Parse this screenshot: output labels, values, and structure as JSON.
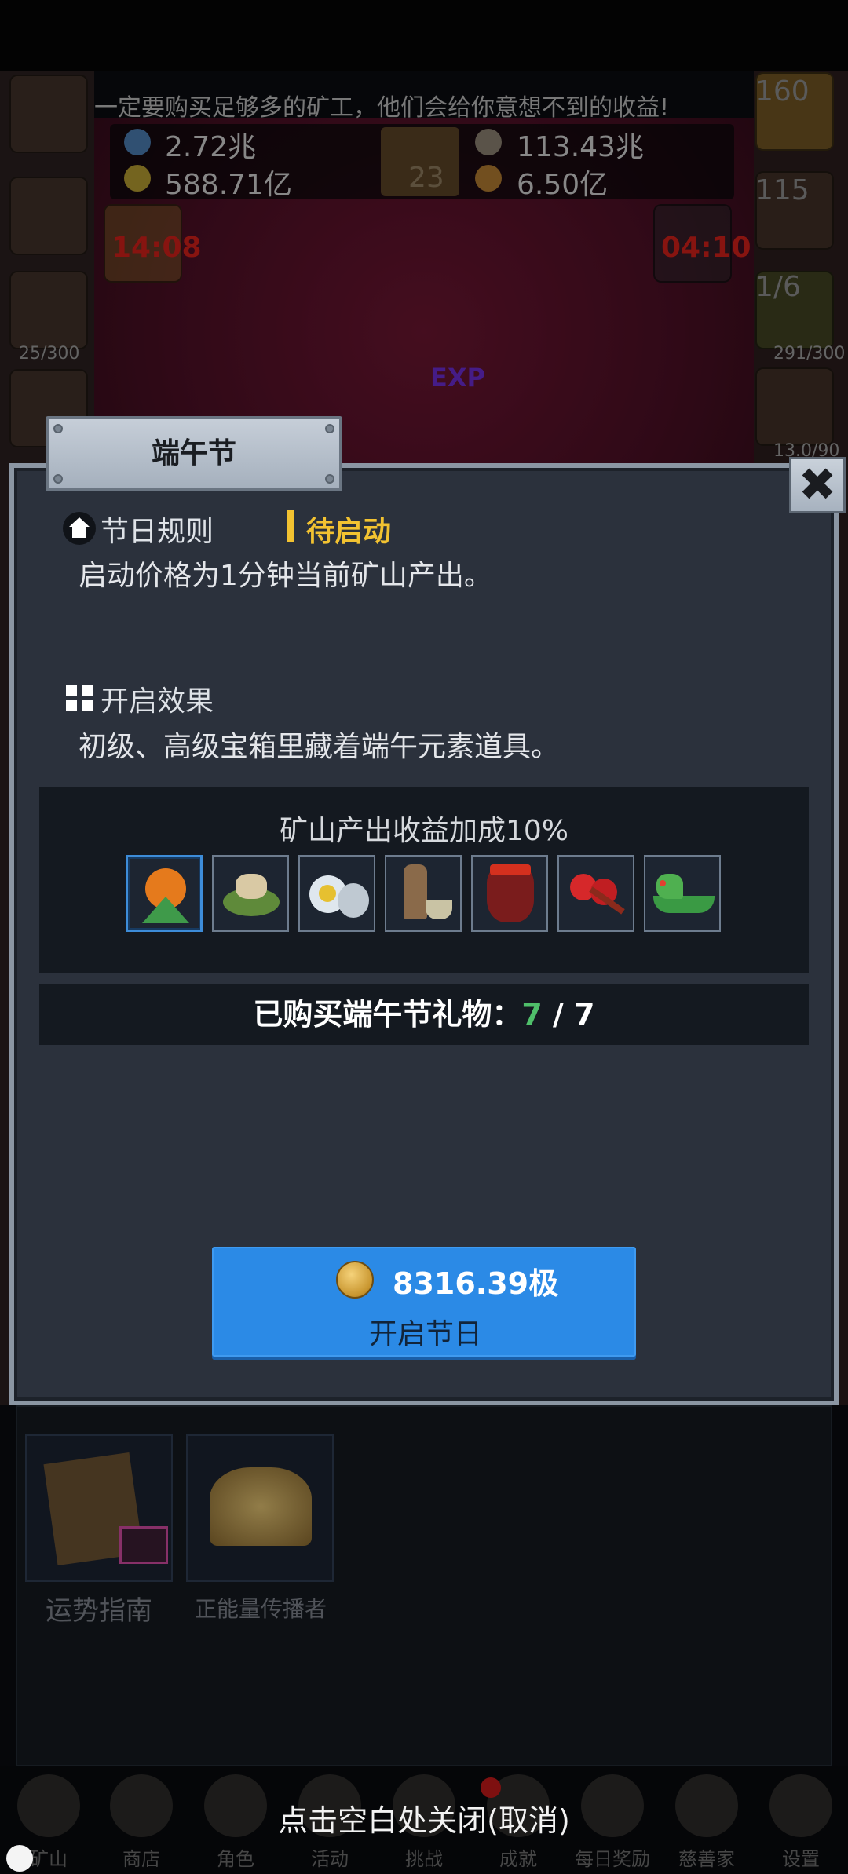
{
  "scene": {
    "notice_text": "一定要购买足够多的矿工，他们会给你意想不到的收益!",
    "resources": [
      {
        "icon": "water-bottle-icon",
        "value": "2.72兆"
      },
      {
        "icon": "stone-icon",
        "value": "113.43兆"
      },
      {
        "icon": "potion-icon",
        "value": "588.71亿"
      },
      {
        "icon": "bread-icon",
        "value": "6.50亿"
      }
    ],
    "book_count": "23",
    "left_timer": "14:08",
    "right_timer": "04:10",
    "right_counter_top": "160",
    "right_counter_chest": "115",
    "right_fraction": "1/6",
    "right_progress": "291/300",
    "right_progress_small": "13.0/90",
    "left_progress": "25/300",
    "exp_label": "EXP"
  },
  "lower_cards": [
    {
      "icon": "fortune-map-icon",
      "label": "运势指南"
    },
    {
      "icon": "crown-icon",
      "label": "正能量传播者"
    }
  ],
  "bottom_nav": {
    "close_hint": "点击空白处关闭(取消)",
    "items": [
      {
        "icon": "lantern-icon",
        "label": "矿山"
      },
      {
        "icon": "ore-icon",
        "label": "商店"
      },
      {
        "icon": "skull-icon",
        "label": "角色"
      },
      {
        "icon": "pickaxe-icon",
        "label": "活动"
      },
      {
        "icon": "sword-icon",
        "label": "挑战"
      },
      {
        "icon": "key-icon",
        "label": "成就"
      },
      {
        "icon": "envelope-icon",
        "label": "每日奖励"
      },
      {
        "icon": "bread-bag-icon",
        "label": "慈善家"
      },
      {
        "icon": "gear-icon",
        "label": "设置"
      }
    ]
  },
  "modal": {
    "title": "端午节",
    "close_symbol": "✖",
    "rules": {
      "title": "节日规则",
      "status": "待启动",
      "text": "启动价格为1分钟当前矿山产出。"
    },
    "effect": {
      "title": "开启效果",
      "text": "初级、高级宝箱里藏着端午元素道具。"
    },
    "bonus": {
      "title": "矿山产出收益加成10%",
      "items": [
        {
          "icon": "zongzi-sage-icon"
        },
        {
          "icon": "zongzi-plate-icon"
        },
        {
          "icon": "salted-egg-icon"
        },
        {
          "icon": "realgar-wine-icon"
        },
        {
          "icon": "wine-jar-icon"
        },
        {
          "icon": "drum-sticks-icon"
        },
        {
          "icon": "dragon-boat-icon"
        }
      ]
    },
    "purchased": {
      "label": "已购买端午节礼物：",
      "count": "7",
      "separator": " / ",
      "total": "7"
    },
    "start_button": {
      "cost": "8316.39极",
      "label": "开启节日"
    }
  },
  "colors": {
    "modal_bg": "#2b313c",
    "accent_blue": "#2b8ae6",
    "status_yellow": "#f2c231",
    "count_green": "#4fbf6a",
    "timer_red": "#d0201a"
  }
}
